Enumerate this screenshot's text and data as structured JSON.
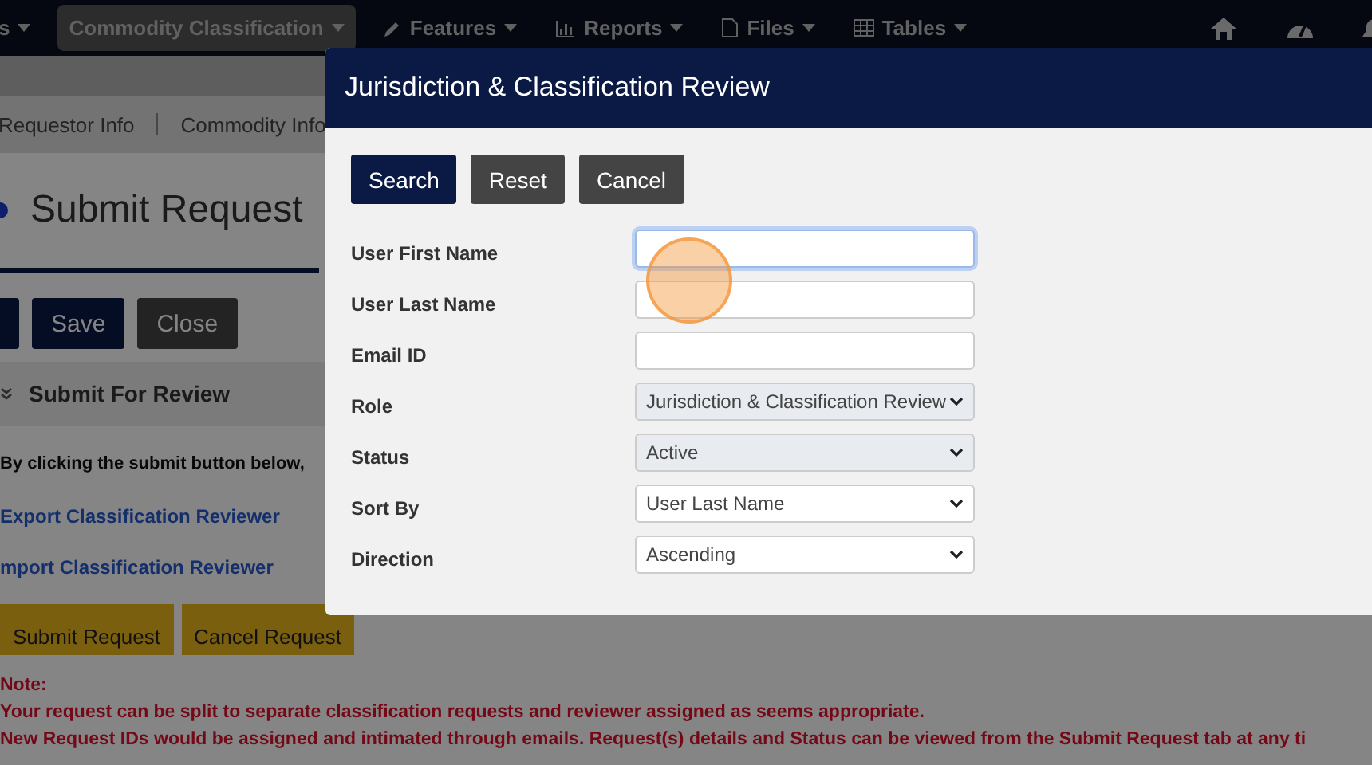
{
  "nav": {
    "items": [
      {
        "label": "s",
        "active": false
      },
      {
        "label": "Commodity Classification",
        "active": true
      },
      {
        "label": "Features",
        "active": false
      },
      {
        "label": "Reports",
        "active": false
      },
      {
        "label": "Files",
        "active": false
      },
      {
        "label": "Tables",
        "active": false
      }
    ]
  },
  "breadcrumb": [
    "Requestor Info",
    "Commodity Info"
  ],
  "page_title": "Submit Request",
  "page_buttons": [
    {
      "kind": "primary"
    },
    {
      "label": "Save",
      "kind": "primary"
    },
    {
      "label": "Close",
      "kind": "secondary"
    }
  ],
  "section_title": "Submit For Review",
  "intro": "By clicking the submit button below,",
  "links": [
    "Export Classification Reviewer",
    "mport Classification Reviewer"
  ],
  "action_buttons": [
    "Submit Request",
    "Cancel Request"
  ],
  "notes": [
    "Note:",
    "Your request can be split to separate classification requests and reviewer assigned as seems appropriate.",
    "New Request IDs would be assigned and intimated through emails. Request(s) details and Status can be viewed from the Submit Request tab at any ti"
  ],
  "dialog": {
    "title": "Jurisdiction & Classification Review",
    "buttons": [
      {
        "label": "Search",
        "kind": "primary"
      },
      {
        "label": "Reset",
        "kind": "secondary"
      },
      {
        "label": "Cancel",
        "kind": "secondary"
      }
    ],
    "fields": [
      {
        "kind": "text",
        "label": "User First Name",
        "focused": true
      },
      {
        "kind": "text",
        "label": "User Last Name",
        "focused": false
      },
      {
        "kind": "text",
        "label": "Email ID",
        "focused": false
      },
      {
        "kind": "select",
        "label": "Role",
        "value": "Jurisdiction & Classification Review",
        "disabled": true
      },
      {
        "kind": "select",
        "label": "Status",
        "value": "Active",
        "disabled": true
      },
      {
        "kind": "select",
        "label": "Sort By",
        "value": "User Last Name",
        "disabled": false
      },
      {
        "kind": "select",
        "label": "Direction",
        "value": "Ascending",
        "disabled": false
      }
    ]
  }
}
